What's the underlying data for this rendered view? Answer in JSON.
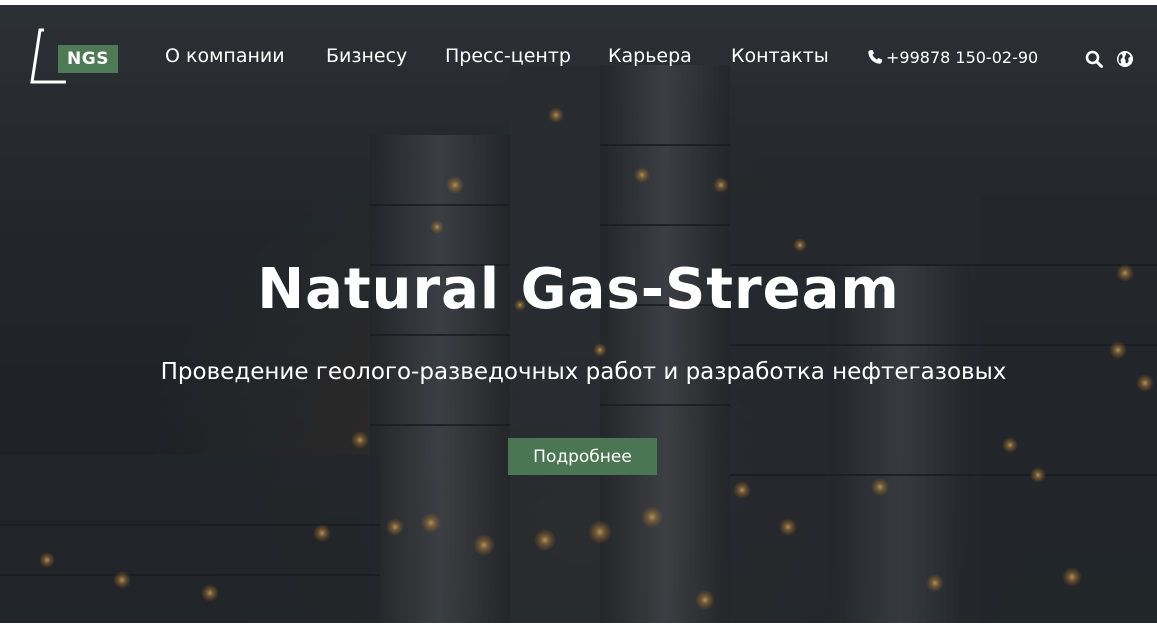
{
  "logo": {
    "text": "NGS",
    "badge_color": "#4e7a56"
  },
  "nav": {
    "items": [
      {
        "label": "О компании"
      },
      {
        "label": "Бизнесу"
      },
      {
        "label": "Пресс-центр"
      },
      {
        "label": "Карьера"
      },
      {
        "label": "Контакты"
      }
    ],
    "phone": "+99878 150-02-90",
    "icons": [
      "phone-icon",
      "search-icon",
      "globe-icon"
    ]
  },
  "hero": {
    "title": "Natural Gas-Stream",
    "subtitle": "Проведение геолого-разведочных работ и разработка нефтегазовых",
    "cta_label": "Подробнее",
    "cta_color": "#4b7653"
  }
}
